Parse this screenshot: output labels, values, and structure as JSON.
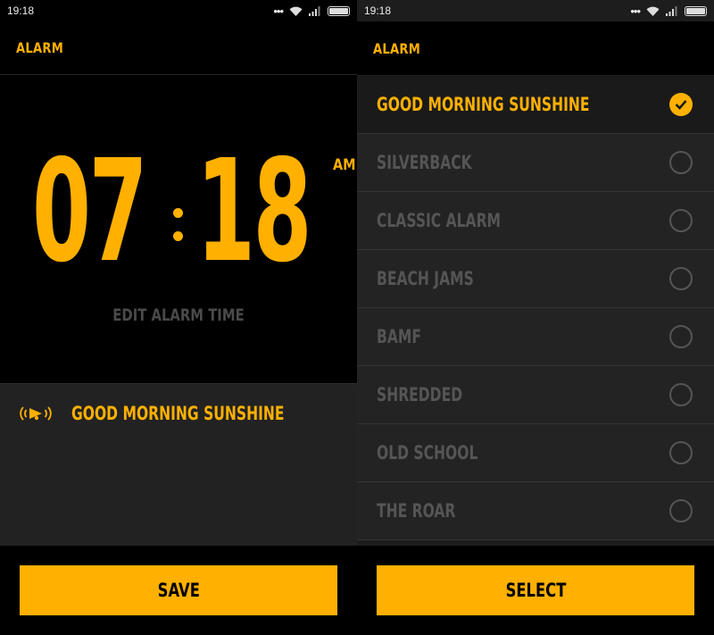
{
  "left_screen": {
    "status": {
      "time": "19:18"
    },
    "header": {
      "title": "ALARM"
    },
    "clock": {
      "hours": "07",
      "minutes": "18",
      "ampm": "AM",
      "edit_label": "EDIT ALARM TIME"
    },
    "sound": {
      "icon": "ringtone-bell-icon",
      "name": "GOOD MORNING SUNSHINE"
    },
    "save_label": "SAVE"
  },
  "right_screen": {
    "status": {
      "time": "19:18"
    },
    "header": {
      "title": "ALARM"
    },
    "ringtones": [
      {
        "label": "GOOD MORNING SUNSHINE",
        "selected": true
      },
      {
        "label": "SILVERBACK",
        "selected": false
      },
      {
        "label": "CLASSIC ALARM",
        "selected": false
      },
      {
        "label": "BEACH JAMS",
        "selected": false
      },
      {
        "label": "BAMF",
        "selected": false
      },
      {
        "label": "SHREDDED",
        "selected": false
      },
      {
        "label": "OLD SCHOOL",
        "selected": false
      },
      {
        "label": "THE ROAR",
        "selected": false
      }
    ],
    "select_label": "SELECT"
  },
  "colors": {
    "accent": "#ffb000",
    "background": "#000000",
    "panel": "#222222",
    "muted_text": "#555555"
  }
}
